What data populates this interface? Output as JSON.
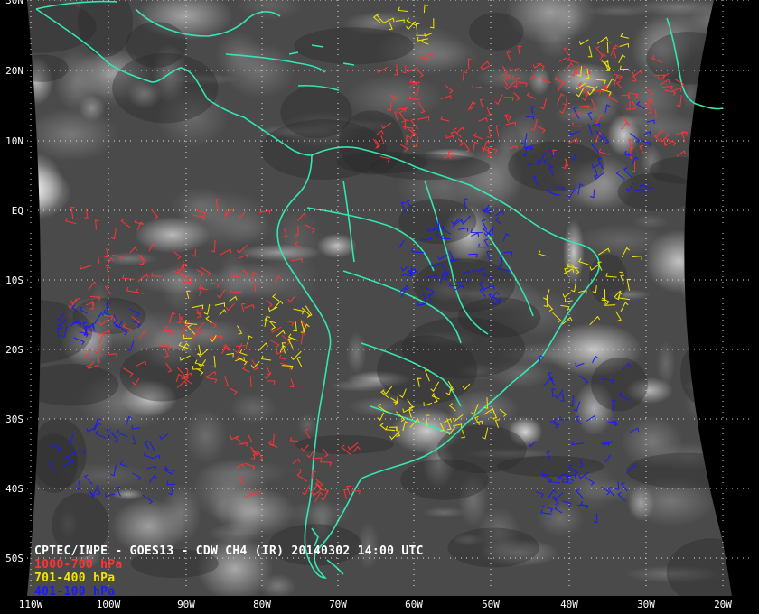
{
  "caption": {
    "title": "CPTEC/INPE - GOES13 - CDW CH4 (IR) 20140302 14:00 UTC",
    "legend": [
      {
        "label": "1000-700 hPa",
        "color": "#ff3333"
      },
      {
        "label": "701-400 hPa",
        "color": "#f2e600"
      },
      {
        "label": "401-100 hPa",
        "color": "#1a1aff"
      }
    ],
    "title_color": "#ffffff"
  },
  "colors": {
    "coastline": "#33e6b3",
    "grid": "#dddddd",
    "background": "#000000"
  },
  "latitudes": [
    "30N",
    "20N",
    "10N",
    "EQ",
    "10S",
    "20S",
    "30S",
    "40S",
    "50S"
  ],
  "longitudes": [
    "110W",
    "100W",
    "90W",
    "80W",
    "70W",
    "60W",
    "50W",
    "40W",
    "30W",
    "20W"
  ]
}
